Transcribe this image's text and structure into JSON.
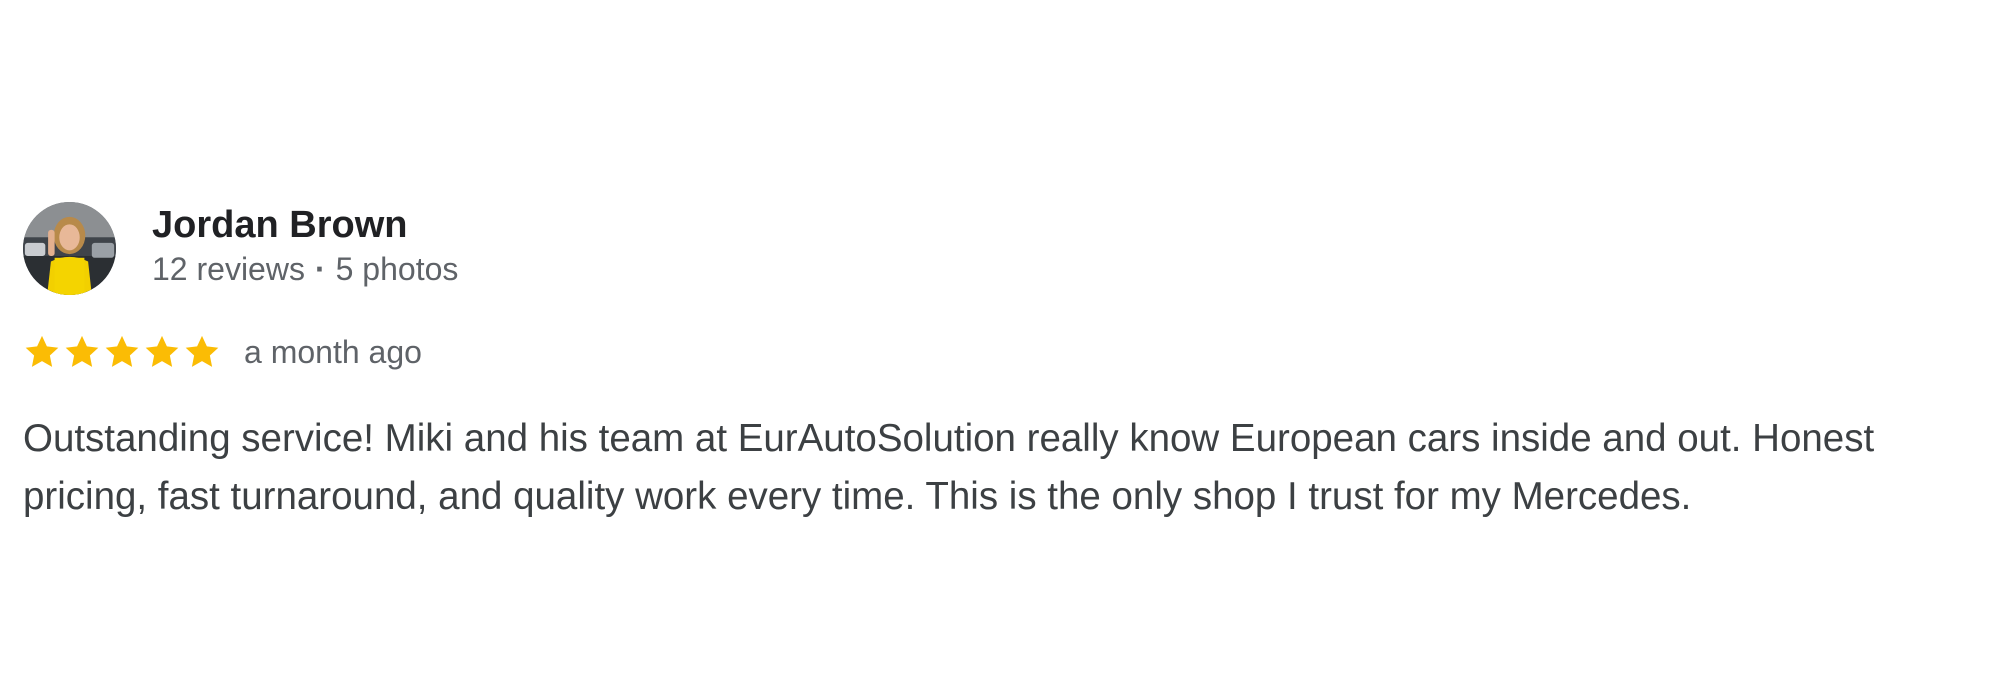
{
  "review": {
    "reviewer_name": "Jordan Brown",
    "review_count": "12 reviews",
    "meta_separator": "·",
    "photo_count": "5 photos",
    "rating": 5,
    "rating_max": 5,
    "date": "a month ago",
    "text": "Outstanding service! Miki and his team at EurAutoSolution really know European cars inside and out. Honest pricing, fast turnaround, and quality work every time. This is the only shop I trust for my Mercedes."
  },
  "icons": {
    "avatar": "profile-photo",
    "star": "star-icon"
  },
  "colors": {
    "star": "#fbbc04",
    "name": "#202124",
    "meta": "#5f6368",
    "body_text": "#3c4043"
  }
}
